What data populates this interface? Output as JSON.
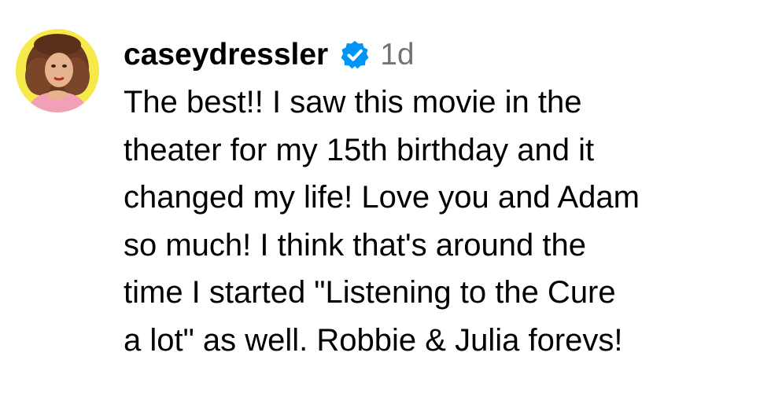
{
  "comment": {
    "username": "caseydressler",
    "verified": true,
    "timestamp": "1d",
    "text_lines": [
      "The best!! I saw this movie in the",
      "theater for my 15th birthday and it",
      "changed my life! Love you and Adam",
      "so much! I think that's around the",
      "time I started \"Listening to the Cure",
      "a lot\" as well. Robbie & Julia forevs!"
    ]
  },
  "colors": {
    "avatar_ring": "#f6e94a",
    "verified_badge": "#0095f6",
    "timestamp": "#737373",
    "text": "#000000"
  },
  "icons": {
    "avatar": "profile-photo",
    "verified": "verified-badge-icon"
  }
}
